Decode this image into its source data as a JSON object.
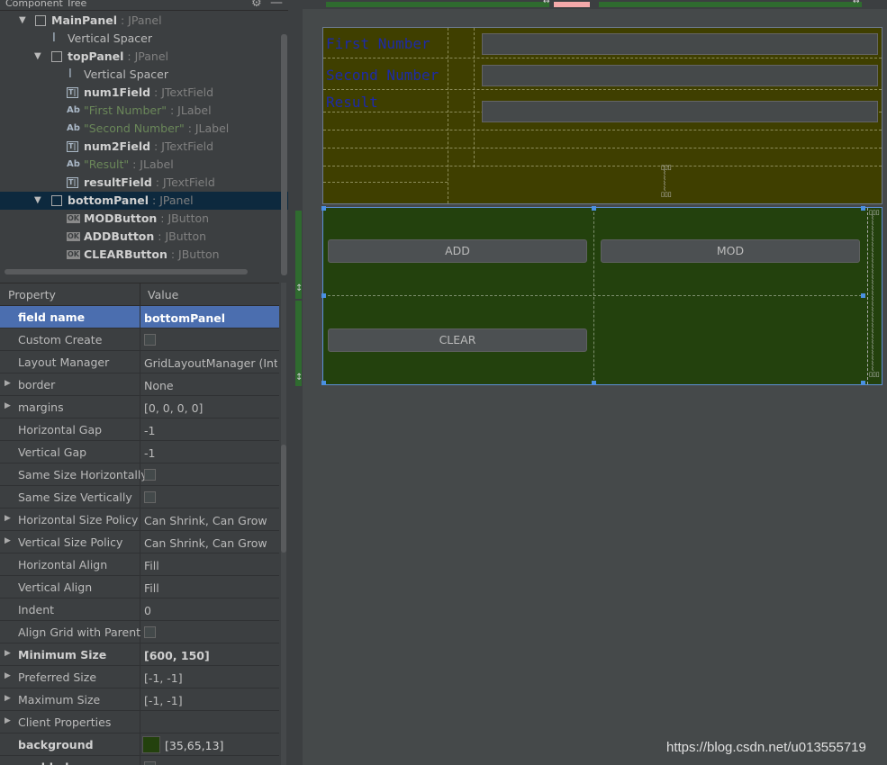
{
  "tree": {
    "title": "Component Tree",
    "nodes": [
      {
        "label": "MainPanel",
        "type": ": JPanel"
      },
      {
        "label": "Vertical Spacer"
      },
      {
        "label": "topPanel",
        "type": ": JPanel"
      },
      {
        "label": "Vertical Spacer"
      },
      {
        "label": "num1Field",
        "type": ": JTextField"
      },
      {
        "label": "\"First Number\"",
        "type": ": JLabel"
      },
      {
        "label": "\"Second Number\"",
        "type": ": JLabel"
      },
      {
        "label": "num2Field",
        "type": ": JTextField"
      },
      {
        "label": "\"Result\"",
        "type": ": JLabel"
      },
      {
        "label": "resultField",
        "type": ": JTextField"
      },
      {
        "label": "bottomPanel",
        "type": ": JPanel"
      },
      {
        "label": "MODButton",
        "type": ": JButton"
      },
      {
        "label": "ADDButton",
        "type": ": JButton"
      },
      {
        "label": "CLEARButton",
        "type": ": JButton"
      }
    ]
  },
  "props": {
    "header_property": "Property",
    "header_value": "Value",
    "rows": [
      {
        "name": "field name",
        "value": "bottomPanel"
      },
      {
        "name": "Custom Create",
        "value": ""
      },
      {
        "name": "Layout Manager",
        "value": "GridLayoutManager (Int..."
      },
      {
        "name": "border",
        "value": "None"
      },
      {
        "name": "margins",
        "value": "[0, 0, 0, 0]"
      },
      {
        "name": "Horizontal Gap",
        "value": "-1"
      },
      {
        "name": "Vertical Gap",
        "value": "-1"
      },
      {
        "name": "Same Size Horizontally",
        "value": ""
      },
      {
        "name": "Same Size Vertically",
        "value": ""
      },
      {
        "name": "Horizontal Size Policy",
        "value": "Can Shrink, Can Grow"
      },
      {
        "name": "Vertical Size Policy",
        "value": "Can Shrink, Can Grow"
      },
      {
        "name": "Horizontal Align",
        "value": "Fill"
      },
      {
        "name": "Vertical Align",
        "value": "Fill"
      },
      {
        "name": "Indent",
        "value": "0"
      },
      {
        "name": "Align Grid with Parent",
        "value": ""
      },
      {
        "name": "Minimum Size",
        "value": "[600, 150]"
      },
      {
        "name": "Preferred Size",
        "value": "[-1, -1]"
      },
      {
        "name": "Maximum Size",
        "value": "[-1, -1]"
      },
      {
        "name": "Client Properties",
        "value": ""
      },
      {
        "name": "background",
        "value": "[35,65,13]"
      },
      {
        "name": "enabled",
        "value": ""
      }
    ]
  },
  "designer": {
    "labels": {
      "first": "First Number",
      "second": "Second Number",
      "result": "Result"
    },
    "buttons": {
      "add": "ADD",
      "mod": "MOD",
      "clear": "CLEAR"
    },
    "colors": {
      "top_panel_bg": "#3f3f00",
      "bottom_panel_bg": "#23410d",
      "label_color": "#1d2aa8",
      "selection": "#4a90e2"
    }
  },
  "watermark": "https://blog.csdn.net/u013555719"
}
